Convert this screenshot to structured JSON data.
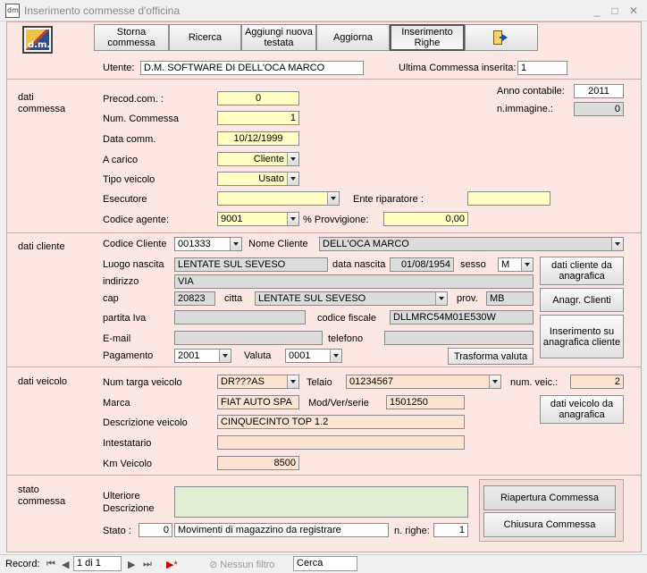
{
  "window": {
    "title": "Inserimento commesse d'officina",
    "minimize": "_",
    "maximize": "□",
    "close": "✕"
  },
  "logo_text": "d.m.",
  "toolbar": {
    "storna": "Storna commessa",
    "ricerca": "Ricerca",
    "aggiungi": "Aggiungi nuova testata",
    "aggiorna": "Aggiorna",
    "inserimento": "Inserimento Righe"
  },
  "header": {
    "utente_label": "Utente:",
    "utente": "D.M. SOFTWARE DI DELL'OCA MARCO",
    "ultima_label": "Ultima Commessa inserita:",
    "ultima": "1"
  },
  "commessa": {
    "section": "dati commessa",
    "precod_label": "Precod.com. :",
    "precod": "0",
    "num_label": "Num. Commessa",
    "num": "1",
    "data_label": "Data comm.",
    "data": "10/12/1999",
    "acarico_label": "A carico",
    "acarico": "Cliente",
    "tipo_label": "Tipo veicolo",
    "tipo": "Usato",
    "esecutore_label": "Esecutore",
    "esecutore": "",
    "ente_label": "Ente riparatore :",
    "ente": "",
    "agente_label": "Codice agente:",
    "agente": "9001",
    "provv_label": "% Provvigione:",
    "provv": "0,00",
    "anno_label": "Anno contabile:",
    "anno": "2011",
    "nimm_label": "n.immagine.:",
    "nimm": "0"
  },
  "cliente": {
    "section": "dati cliente",
    "codice_label": "Codice Cliente",
    "codice": "001333",
    "nome_label": "Nome Cliente",
    "nome": "DELL'OCA MARCO",
    "luogo_label": "Luogo nascita",
    "luogo": "LENTATE SUL SEVESO",
    "datan_label": "data nascita",
    "datan": "01/08/1954",
    "sesso_label": "sesso",
    "sesso": "M",
    "indirizzo_label": "indirizzo",
    "indirizzo": "VIA",
    "cap_label": "cap",
    "cap": "20823",
    "citta_label": "citta",
    "citta": "LENTATE SUL SEVESO",
    "prov_label": "prov.",
    "prov": "MB",
    "piva_label": "partita Iva",
    "piva": "",
    "cf_label": "codice fiscale",
    "cf": "DLLMRC54M01E530W",
    "email_label": "E-mail",
    "email": "",
    "tel_label": "telefono",
    "tel": "",
    "pagamento_label": "Pagamento",
    "pagamento": "2001",
    "valuta_label": "Valuta",
    "valuta": "0001",
    "btn_trasforma": "Trasforma valuta",
    "btn_dati_anag": "dati cliente da anagrafica",
    "btn_anagr": "Anagr. Clienti",
    "btn_ins_anag": "Inserimento su anagrafica cliente"
  },
  "veicolo": {
    "section": "dati veicolo",
    "targa_label": "Num targa veicolo",
    "targa": "DR???AS",
    "telaio_label": "Telaio",
    "telaio": "01234567",
    "numveic_label": "num. veic.:",
    "numveic": "2",
    "marca_label": "Marca",
    "marca": "FIAT AUTO SPA",
    "mod_label": "Mod/Ver/serie",
    "mod": "1501250",
    "desc_label": "Descrizione veicolo",
    "desc": "CINQUECINTO TOP 1.2",
    "intest_label": "Intestatario",
    "intest": "",
    "km_label": "Km Veicolo",
    "km": "8500",
    "btn_dati_veic": "dati veicolo da anagrafica"
  },
  "stato": {
    "section": "stato commessa",
    "ulteriore_label": "Ulteriore Descrizione",
    "ulteriore": "",
    "stato_label": "Stato :",
    "stato_code": "0",
    "stato_text": "Movimenti di magazzino da registrare",
    "righe_label": "n. righe:",
    "righe": "1",
    "btn_riapertura": "Riapertura Commessa",
    "btn_chiusura": "Chiusura Commessa"
  },
  "statusbar": {
    "record_label": "Record:",
    "first": "⏮",
    "prev": "◀",
    "record": "1 di 1",
    "next": "▶",
    "last": "⏭",
    "new": "▶*",
    "filter": "Nessun filtro",
    "search": "Cerca"
  }
}
